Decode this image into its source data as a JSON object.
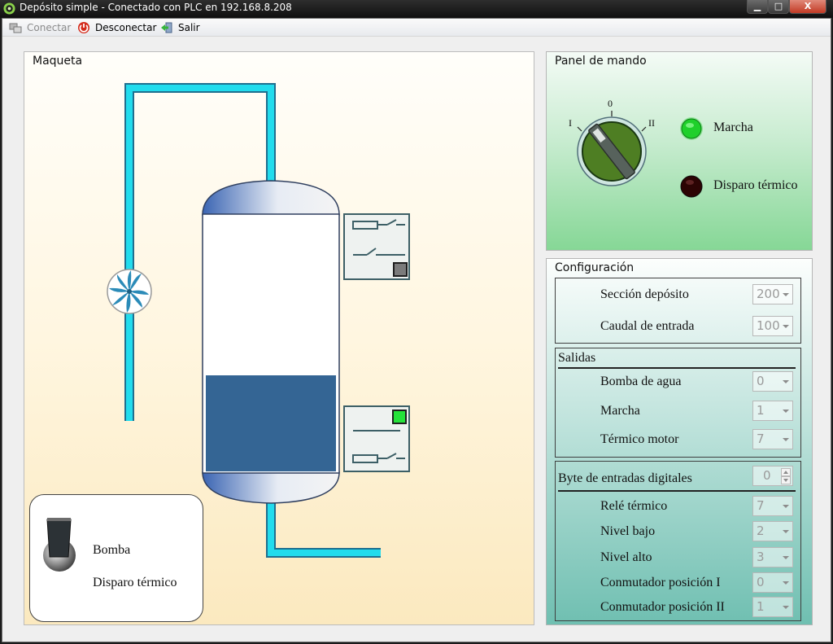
{
  "window": {
    "title": "Depósito simple - Conectado con PLC en 192.168.8.208",
    "minimize_label": "▁",
    "maximize_label": "□",
    "close_label": "X"
  },
  "menu": {
    "conectar": "Conectar",
    "desconectar": "Desconectar",
    "salir": "Salir"
  },
  "maqueta": {
    "label": "Maqueta",
    "tank_fill_level": 0.37,
    "legend": {
      "bomba": "Bomba",
      "disparo": "Disparo térmico"
    }
  },
  "panel_mando": {
    "label": "Panel de mando",
    "switch_positions": [
      "I",
      "0",
      "II"
    ],
    "lamps": {
      "marcha": "Marcha",
      "disparo": "Disparo térmico"
    },
    "colors": {
      "marcha_on": "#22d62e",
      "disparo_off": "#3a0606"
    }
  },
  "config": {
    "label": "Configuración",
    "deposito": [
      {
        "label": "Sección depósito",
        "value": "200"
      },
      {
        "label": "Caudal de entrada",
        "value": "100"
      }
    ],
    "salidas": {
      "title": "Salidas",
      "rows": [
        {
          "label": "Bomba de agua",
          "value": "0"
        },
        {
          "label": "Marcha",
          "value": "1"
        },
        {
          "label": "Térmico motor",
          "value": "7"
        }
      ]
    },
    "entradas": {
      "title": "Byte de entradas digitales",
      "byte_value": "0",
      "rows": [
        {
          "label": "Relé térmico",
          "value": "7"
        },
        {
          "label": "Nivel bajo",
          "value": "2"
        },
        {
          "label": "Nivel alto",
          "value": "3"
        },
        {
          "label": "Conmutador posición I",
          "value": "0"
        },
        {
          "label": "Conmutador posición II",
          "value": "1"
        }
      ]
    }
  }
}
